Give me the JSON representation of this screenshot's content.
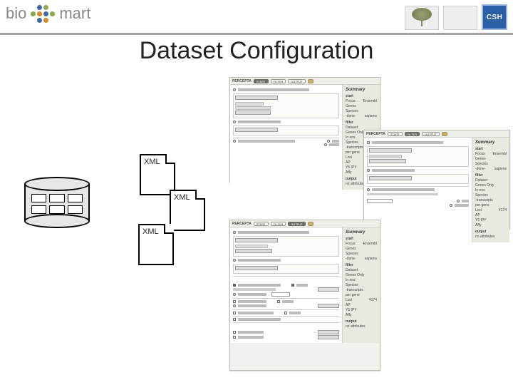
{
  "header": {
    "logo_left": "bio",
    "logo_right": "mart",
    "badge": "CSH"
  },
  "title": "Dataset Configuration",
  "xml_label": "XML",
  "window": {
    "brand": "PERCEPTA",
    "steps": {
      "start": "START",
      "filter": "FILTER",
      "output": "OUTPUT"
    },
    "summary_title": "Summary",
    "section": {
      "start": "start",
      "filter": "filter",
      "output": "output"
    },
    "summary_start": [
      {
        "l": "Focus",
        "r": "Ensembl"
      },
      {
        "l": "Genes",
        "r": ""
      },
      {
        "l": "Species",
        "r": ""
      },
      {
        "l": "-done-",
        "r": "sapiens"
      }
    ],
    "summary_filter": [
      {
        "l": "Dataset",
        "r": ""
      },
      {
        "l": "Genes Only",
        "r": ""
      },
      {
        "l": "In ens",
        "r": ""
      },
      {
        "l": "Species",
        "r": ""
      },
      {
        "l": "-transcripts",
        "r": ""
      },
      {
        "l": "per gene",
        "r": ""
      },
      {
        "l": "Loci",
        "r": "4174"
      },
      {
        "l": "AP",
        "r": ""
      },
      {
        "l": "Y5    IPY",
        "r": ""
      },
      {
        "l": "Affy",
        "r": ""
      }
    ],
    "summary_output": [
      {
        "l": "no attributes",
        "r": ""
      }
    ]
  }
}
